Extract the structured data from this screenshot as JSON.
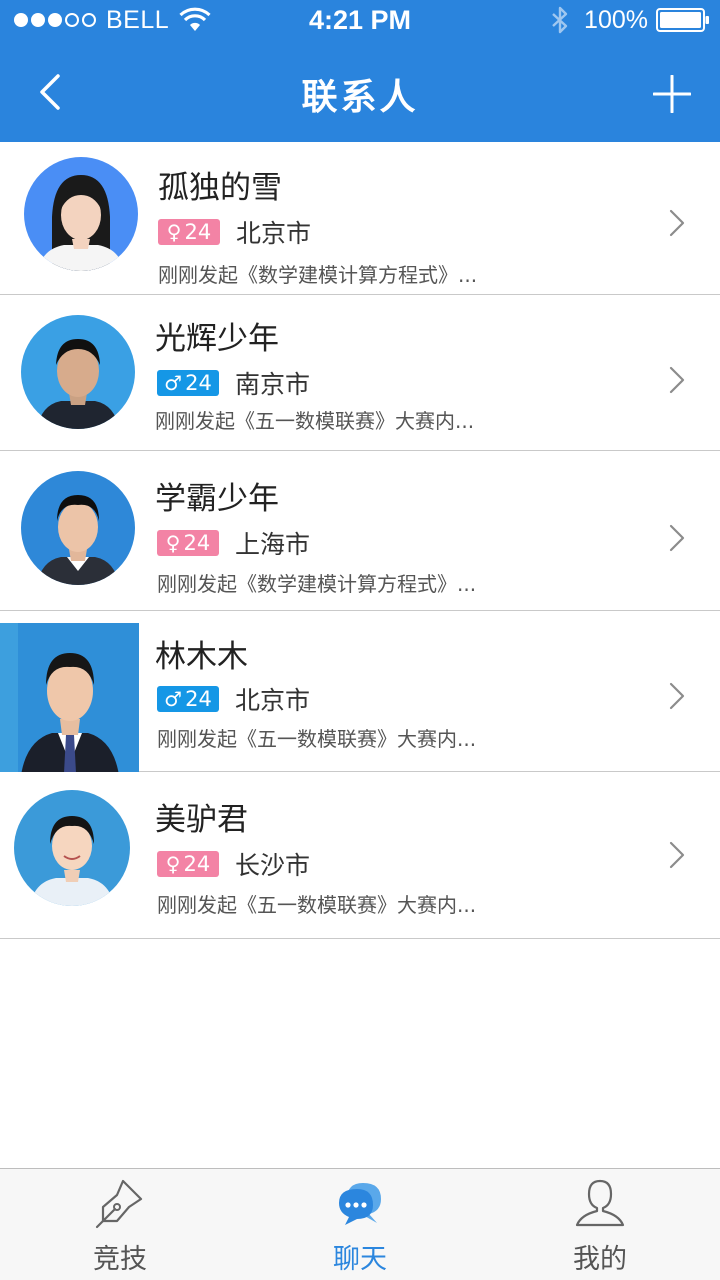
{
  "status_bar": {
    "carrier": "BELL",
    "time": "4:21 PM",
    "battery": "100%"
  },
  "nav": {
    "title": "联系人"
  },
  "contacts": [
    {
      "name": "孤独的雪",
      "gender": "female",
      "gender_symbol": "♀",
      "age": "24",
      "city": "北京市",
      "desc": "刚刚发起《数学建模计算方程式》..."
    },
    {
      "name": "光辉少年",
      "gender": "male",
      "gender_symbol": "♂",
      "age": "24",
      "city": "南京市",
      "desc": "刚刚发起《五一数模联赛》大赛内..."
    },
    {
      "name": "学霸少年",
      "gender": "female",
      "gender_symbol": "♀",
      "age": "24",
      "city": "上海市",
      "desc": "刚刚发起《数学建模计算方程式》..."
    },
    {
      "name": "林木木",
      "gender": "male",
      "gender_symbol": "♂",
      "age": "24",
      "city": "北京市",
      "desc": "刚刚发起《五一数模联赛》大赛内..."
    },
    {
      "name": "美驴君",
      "gender": "female",
      "gender_symbol": "♀",
      "age": "24",
      "city": "长沙市",
      "desc": "刚刚发起《五一数模联赛》大赛内..."
    }
  ],
  "tabs": [
    {
      "label": "竞技",
      "icon": "pen-nib-icon",
      "active": false
    },
    {
      "label": "聊天",
      "icon": "chat-bubble-icon",
      "active": true
    },
    {
      "label": "我的",
      "icon": "user-icon",
      "active": false
    }
  ],
  "colors": {
    "primary": "#2a84dd",
    "female_badge": "#f383a5",
    "male_badge": "#1597e6",
    "active_tab": "#2b86de"
  }
}
